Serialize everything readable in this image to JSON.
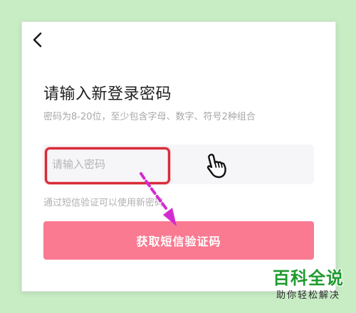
{
  "header": {
    "back_icon": "chevron-left-icon"
  },
  "form": {
    "title": "请输入新登录密码",
    "subtitle": "密码为8-20位，至少包含字母、数字、符号2种组合",
    "password_placeholder": "请输入密码",
    "password_value": "",
    "sms_hint": "通过短信验证可以使用新密码",
    "submit_label": "获取短信验证码"
  },
  "colors": {
    "background": "#c8edc5",
    "button": "#f97a91",
    "highlight": "#d92b3a",
    "arrow": "#d42bd0",
    "watermark": "#1f9a2e"
  },
  "overlay": {
    "cursor_icon": "hand-pointer-icon",
    "arrow_icon": "dashed-arrow-icon"
  },
  "watermark": {
    "title": "百科全说",
    "subtitle": "助你轻松解决"
  }
}
